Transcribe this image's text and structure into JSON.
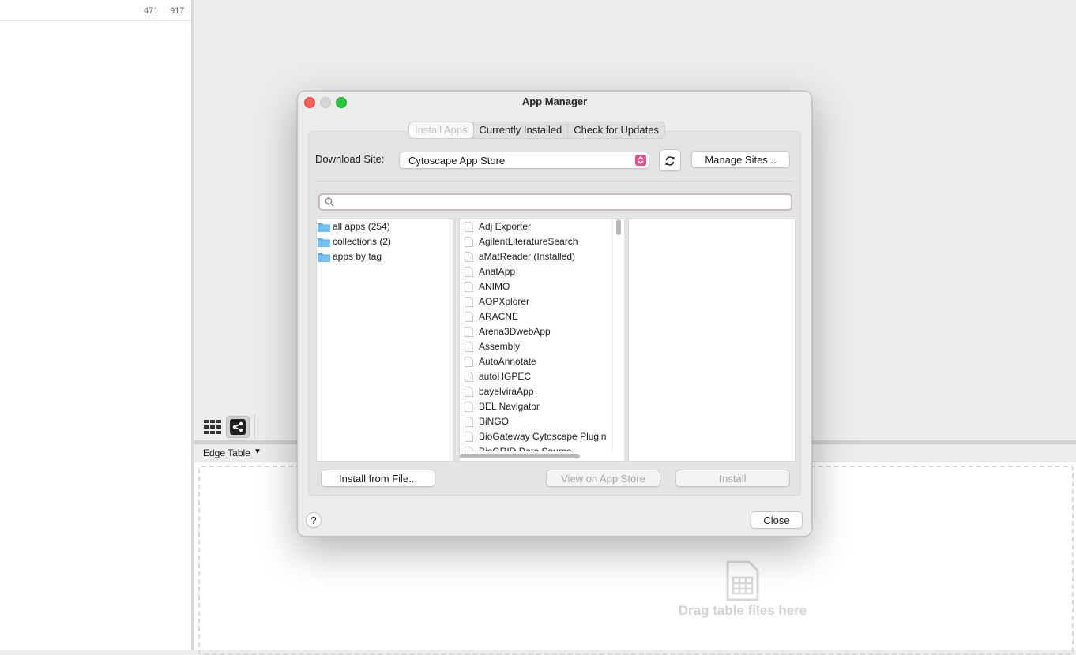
{
  "background": {
    "left_row_values": [
      "471",
      "917"
    ],
    "table_selector": "Edge Table",
    "drop_hint": "Drag table files here",
    "toolbar_icons": [
      "grid-view-icon",
      "network-share-icon"
    ]
  },
  "dialog": {
    "title": "App Manager",
    "tabs": [
      {
        "label": "Install Apps",
        "selected": true
      },
      {
        "label": "Currently Installed",
        "selected": false
      },
      {
        "label": "Check for Updates",
        "selected": false
      }
    ],
    "download_site_label": "Download Site:",
    "download_site_value": "Cytoscape App Store",
    "manage_sites_label": "Manage Sites...",
    "search_value": "",
    "tree": [
      {
        "label": "all apps (254)"
      },
      {
        "label": "collections (2)"
      },
      {
        "label": "apps by tag"
      }
    ],
    "apps": [
      "Adj Exporter",
      "AgilentLiteratureSearch",
      "aMatReader (Installed)",
      "AnatApp",
      "ANIMO",
      "AOPXplorer",
      "ARACNE",
      "Arena3DwebApp",
      "Assembly",
      "AutoAnnotate",
      "autoHGPEC",
      "bayelviraApp",
      "BEL Navigator",
      "BiNGO",
      "BioGateway Cytoscape Plugin",
      "BioGRID Data Source"
    ],
    "install_from_file_label": "Install from File...",
    "view_on_store_label": "View on App Store",
    "install_label": "Install",
    "help_label": "?",
    "close_label": "Close"
  }
}
